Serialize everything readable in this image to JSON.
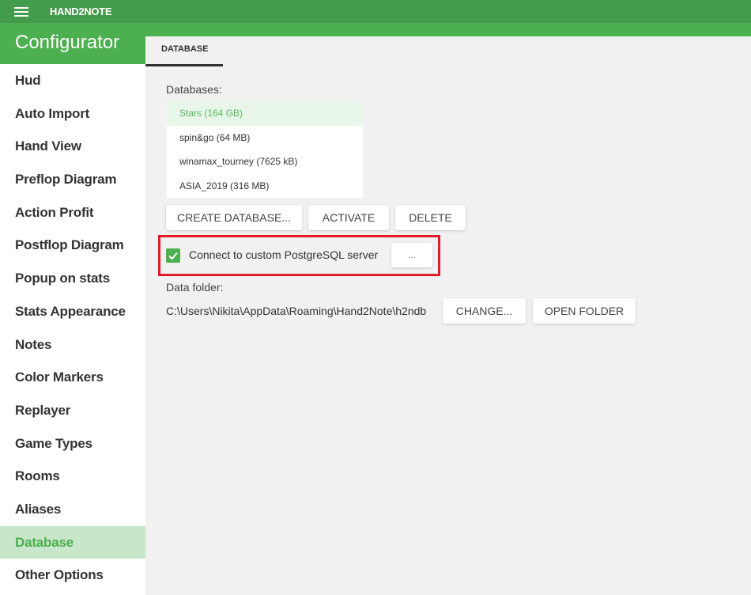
{
  "window": {
    "app_title": "HAND2NOTE",
    "menu_icon": "hamburger-menu-icon"
  },
  "sidebar": {
    "title": "Configurator",
    "active_index": 14,
    "items": [
      {
        "label": "Hud"
      },
      {
        "label": "Auto Import"
      },
      {
        "label": "Hand View"
      },
      {
        "label": "Preflop Diagram"
      },
      {
        "label": "Action Profit"
      },
      {
        "label": "Postflop Diagram"
      },
      {
        "label": "Popup on stats"
      },
      {
        "label": "Stats Appearance"
      },
      {
        "label": "Notes"
      },
      {
        "label": "Color Markers"
      },
      {
        "label": "Replayer"
      },
      {
        "label": "Game Types"
      },
      {
        "label": "Rooms"
      },
      {
        "label": "Aliases"
      },
      {
        "label": "Database"
      },
      {
        "label": "Other Options"
      }
    ]
  },
  "tabs": [
    {
      "label": "DATABASE",
      "active": true
    }
  ],
  "database": {
    "list_label": "Databases:",
    "selected_index": 0,
    "databases": [
      {
        "name": "Stars (164 GB)"
      },
      {
        "name": "spin&go (64 MB)"
      },
      {
        "name": "winamax_tourney (7625 kB)"
      },
      {
        "name": "ASIA_2019 (316 MB)"
      }
    ],
    "buttons": {
      "create": "CREATE DATABASE...",
      "activate": "ACTIVATE",
      "delete": "DELETE"
    },
    "custom_server": {
      "label": "Connect to custom PostgreSQL server",
      "checked": true,
      "settings_button": "..."
    },
    "data_folder": {
      "label": "Data folder:",
      "path": "C:\\Users\\Nikita\\AppData\\Roaming\\Hand2Note\\h2ndb",
      "change_button": "CHANGE...",
      "open_button": "OPEN FOLDER"
    }
  },
  "colors": {
    "titlebar": "#439c4c",
    "accent": "#4caf50",
    "sidebar_active_bg": "#c8e6c9",
    "highlight_border": "#e21d25"
  }
}
